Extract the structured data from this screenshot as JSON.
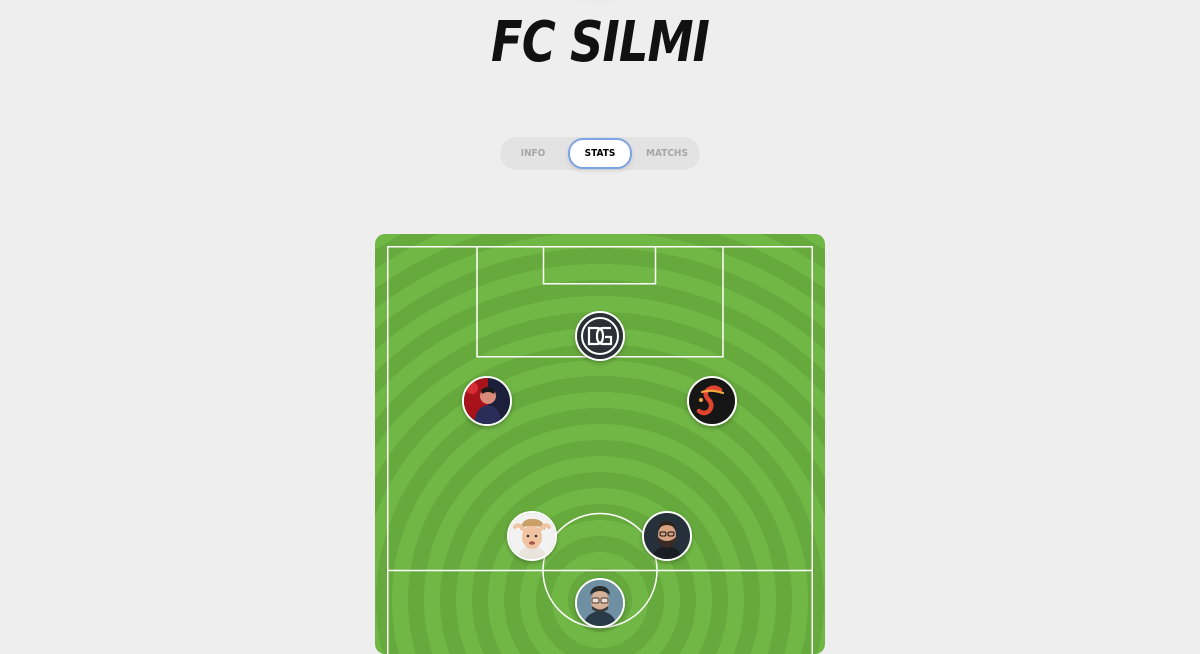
{
  "team": {
    "name": "FC SILMI"
  },
  "tabs": [
    {
      "label": "INFO",
      "active": false
    },
    {
      "label": "STATS",
      "active": true
    },
    {
      "label": "MATCHS",
      "active": false
    }
  ],
  "pitch": {
    "colors": {
      "light": "#71b746",
      "dark": "#66a93d",
      "lines": "#ffffff"
    }
  },
  "players": [
    {
      "id": "goalkeeper",
      "avatar": "dg-monogram-logo-icon"
    },
    {
      "id": "left-defender",
      "avatar": "red-lit-person-icon"
    },
    {
      "id": "right-defender",
      "avatar": "script-s-logo-icon"
    },
    {
      "id": "left-midfielder",
      "avatar": "blond-man-icon"
    },
    {
      "id": "right-midfielder",
      "avatar": "bearded-man-icon"
    },
    {
      "id": "center-midfielder",
      "avatar": "glasses-man-icon"
    }
  ]
}
